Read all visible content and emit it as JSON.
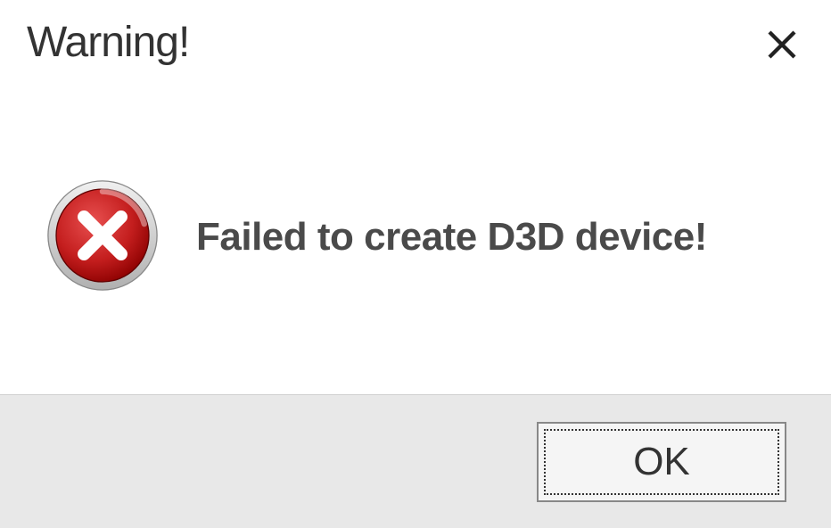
{
  "dialog": {
    "title": "Warning!",
    "message": "Failed to create D3D device!",
    "ok_label": "OK"
  }
}
